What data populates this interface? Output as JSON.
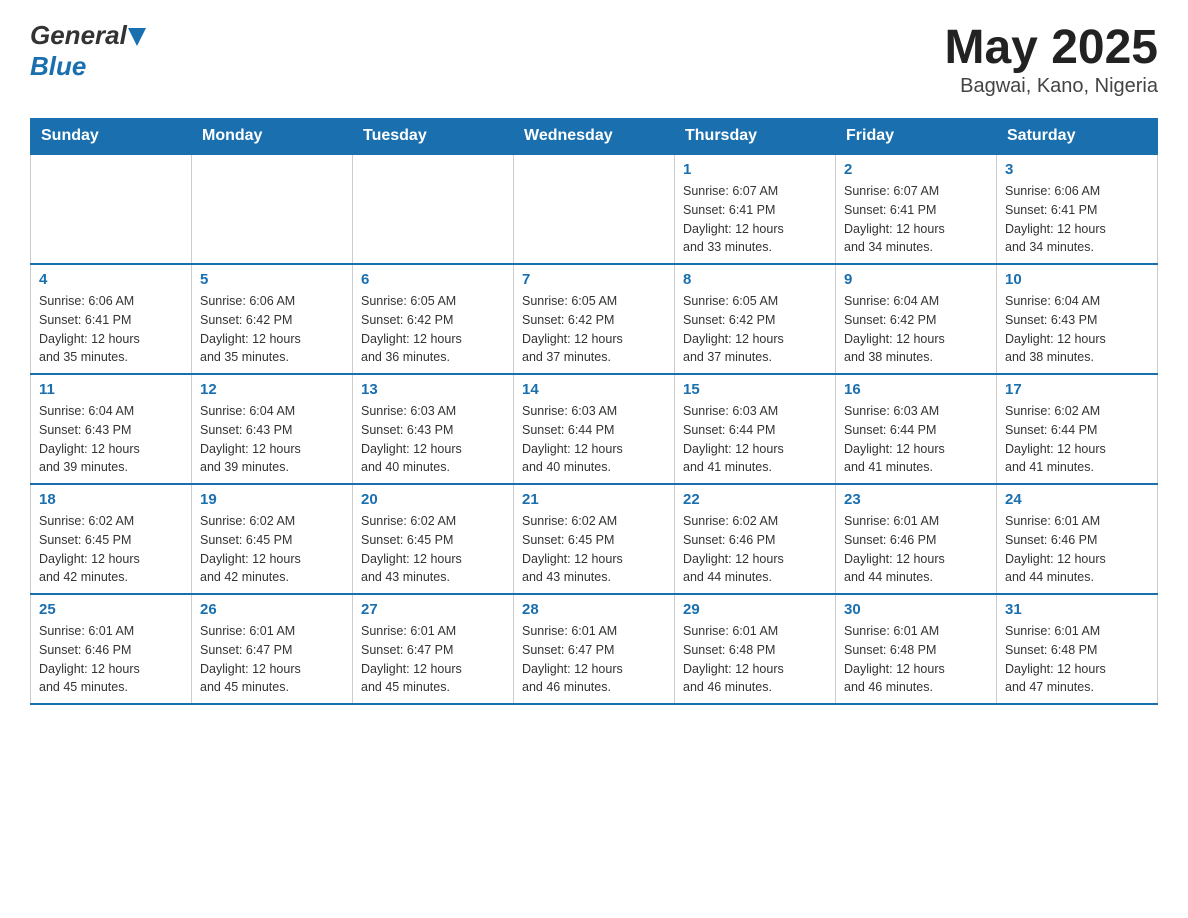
{
  "header": {
    "logo_general": "General",
    "logo_blue": "Blue",
    "title": "May 2025",
    "subtitle": "Bagwai, Kano, Nigeria"
  },
  "weekdays": [
    "Sunday",
    "Monday",
    "Tuesday",
    "Wednesday",
    "Thursday",
    "Friday",
    "Saturday"
  ],
  "weeks": [
    [
      {
        "day": "",
        "info": ""
      },
      {
        "day": "",
        "info": ""
      },
      {
        "day": "",
        "info": ""
      },
      {
        "day": "",
        "info": ""
      },
      {
        "day": "1",
        "info": "Sunrise: 6:07 AM\nSunset: 6:41 PM\nDaylight: 12 hours\nand 33 minutes."
      },
      {
        "day": "2",
        "info": "Sunrise: 6:07 AM\nSunset: 6:41 PM\nDaylight: 12 hours\nand 34 minutes."
      },
      {
        "day": "3",
        "info": "Sunrise: 6:06 AM\nSunset: 6:41 PM\nDaylight: 12 hours\nand 34 minutes."
      }
    ],
    [
      {
        "day": "4",
        "info": "Sunrise: 6:06 AM\nSunset: 6:41 PM\nDaylight: 12 hours\nand 35 minutes."
      },
      {
        "day": "5",
        "info": "Sunrise: 6:06 AM\nSunset: 6:42 PM\nDaylight: 12 hours\nand 35 minutes."
      },
      {
        "day": "6",
        "info": "Sunrise: 6:05 AM\nSunset: 6:42 PM\nDaylight: 12 hours\nand 36 minutes."
      },
      {
        "day": "7",
        "info": "Sunrise: 6:05 AM\nSunset: 6:42 PM\nDaylight: 12 hours\nand 37 minutes."
      },
      {
        "day": "8",
        "info": "Sunrise: 6:05 AM\nSunset: 6:42 PM\nDaylight: 12 hours\nand 37 minutes."
      },
      {
        "day": "9",
        "info": "Sunrise: 6:04 AM\nSunset: 6:42 PM\nDaylight: 12 hours\nand 38 minutes."
      },
      {
        "day": "10",
        "info": "Sunrise: 6:04 AM\nSunset: 6:43 PM\nDaylight: 12 hours\nand 38 minutes."
      }
    ],
    [
      {
        "day": "11",
        "info": "Sunrise: 6:04 AM\nSunset: 6:43 PM\nDaylight: 12 hours\nand 39 minutes."
      },
      {
        "day": "12",
        "info": "Sunrise: 6:04 AM\nSunset: 6:43 PM\nDaylight: 12 hours\nand 39 minutes."
      },
      {
        "day": "13",
        "info": "Sunrise: 6:03 AM\nSunset: 6:43 PM\nDaylight: 12 hours\nand 40 minutes."
      },
      {
        "day": "14",
        "info": "Sunrise: 6:03 AM\nSunset: 6:44 PM\nDaylight: 12 hours\nand 40 minutes."
      },
      {
        "day": "15",
        "info": "Sunrise: 6:03 AM\nSunset: 6:44 PM\nDaylight: 12 hours\nand 41 minutes."
      },
      {
        "day": "16",
        "info": "Sunrise: 6:03 AM\nSunset: 6:44 PM\nDaylight: 12 hours\nand 41 minutes."
      },
      {
        "day": "17",
        "info": "Sunrise: 6:02 AM\nSunset: 6:44 PM\nDaylight: 12 hours\nand 41 minutes."
      }
    ],
    [
      {
        "day": "18",
        "info": "Sunrise: 6:02 AM\nSunset: 6:45 PM\nDaylight: 12 hours\nand 42 minutes."
      },
      {
        "day": "19",
        "info": "Sunrise: 6:02 AM\nSunset: 6:45 PM\nDaylight: 12 hours\nand 42 minutes."
      },
      {
        "day": "20",
        "info": "Sunrise: 6:02 AM\nSunset: 6:45 PM\nDaylight: 12 hours\nand 43 minutes."
      },
      {
        "day": "21",
        "info": "Sunrise: 6:02 AM\nSunset: 6:45 PM\nDaylight: 12 hours\nand 43 minutes."
      },
      {
        "day": "22",
        "info": "Sunrise: 6:02 AM\nSunset: 6:46 PM\nDaylight: 12 hours\nand 44 minutes."
      },
      {
        "day": "23",
        "info": "Sunrise: 6:01 AM\nSunset: 6:46 PM\nDaylight: 12 hours\nand 44 minutes."
      },
      {
        "day": "24",
        "info": "Sunrise: 6:01 AM\nSunset: 6:46 PM\nDaylight: 12 hours\nand 44 minutes."
      }
    ],
    [
      {
        "day": "25",
        "info": "Sunrise: 6:01 AM\nSunset: 6:46 PM\nDaylight: 12 hours\nand 45 minutes."
      },
      {
        "day": "26",
        "info": "Sunrise: 6:01 AM\nSunset: 6:47 PM\nDaylight: 12 hours\nand 45 minutes."
      },
      {
        "day": "27",
        "info": "Sunrise: 6:01 AM\nSunset: 6:47 PM\nDaylight: 12 hours\nand 45 minutes."
      },
      {
        "day": "28",
        "info": "Sunrise: 6:01 AM\nSunset: 6:47 PM\nDaylight: 12 hours\nand 46 minutes."
      },
      {
        "day": "29",
        "info": "Sunrise: 6:01 AM\nSunset: 6:48 PM\nDaylight: 12 hours\nand 46 minutes."
      },
      {
        "day": "30",
        "info": "Sunrise: 6:01 AM\nSunset: 6:48 PM\nDaylight: 12 hours\nand 46 minutes."
      },
      {
        "day": "31",
        "info": "Sunrise: 6:01 AM\nSunset: 6:48 PM\nDaylight: 12 hours\nand 47 minutes."
      }
    ]
  ]
}
